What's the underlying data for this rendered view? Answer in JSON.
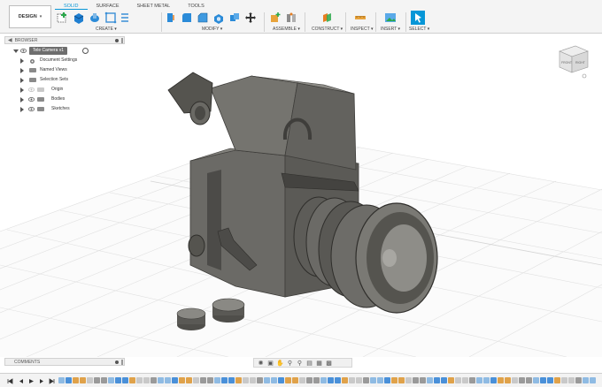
{
  "workspace": {
    "label": "DESIGN",
    "arrow": "▾"
  },
  "tabs": [
    {
      "label": "SOLID",
      "active": true
    },
    {
      "label": "SURFACE",
      "active": false
    },
    {
      "label": "SHEET METAL",
      "active": false
    },
    {
      "label": "TOOLS",
      "active": false
    }
  ],
  "groups": {
    "create": "CREATE ▾",
    "modify": "MODIFY ▾",
    "assemble": "ASSEMBLE ▾",
    "construct": "CONSTRUCT ▾",
    "inspect": "INSPECT ▾",
    "insert": "INSERT ▾",
    "select": "SELECT ▾"
  },
  "browser": {
    "title": "BROWSER",
    "root": "Tele Camera v1",
    "items": [
      {
        "label": "Document Settings",
        "icon": "gear-icon"
      },
      {
        "label": "Named Views",
        "icon": "folder-icon"
      },
      {
        "label": "Selection Sets",
        "icon": "folder-icon"
      },
      {
        "label": "Origin",
        "icon": "folder-icon"
      },
      {
        "label": "Bodies",
        "icon": "folder-icon"
      },
      {
        "label": "Sketches",
        "icon": "folder-icon"
      }
    ]
  },
  "comments": {
    "title": "COMMENTS"
  },
  "viewcube": {
    "faces": [
      "FRONT",
      "RIGHT"
    ]
  },
  "colors": {
    "accent": "#0696d7",
    "model": "#6b6a66",
    "model_dark": "#3f3e3b",
    "grid": "#e3e3e3"
  }
}
